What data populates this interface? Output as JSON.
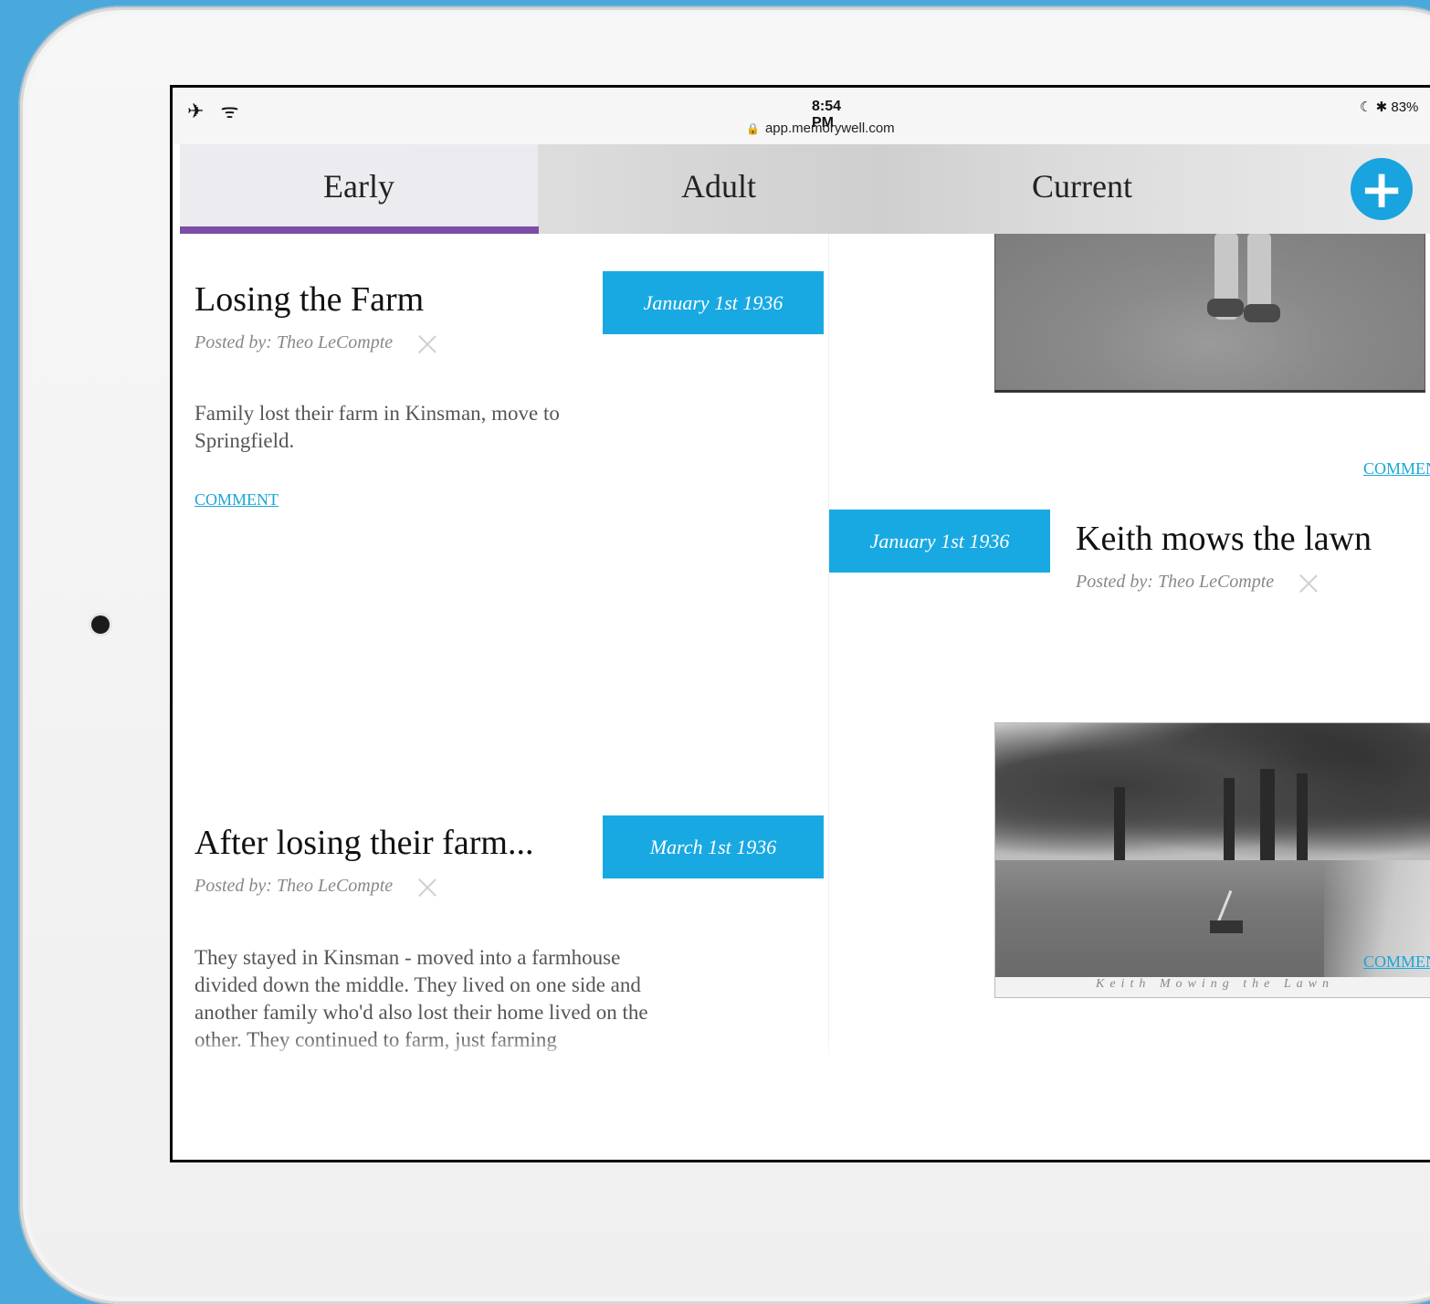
{
  "status_bar": {
    "left_icons": "✈ ᯤ",
    "time": "8:54 PM",
    "url": "app.memorywell.com",
    "battery": "83%",
    "right_icons": "☾ ✱"
  },
  "tabs": [
    {
      "label": "Early"
    },
    {
      "label": "Adult"
    },
    {
      "label": "Current"
    }
  ],
  "add_button": {
    "label": "+"
  },
  "colors": {
    "accent": "#19a9e2",
    "tab_indicator": "#7b4fa6",
    "link": "#1aa7d8"
  },
  "posts": [
    {
      "title": "Losing the Farm",
      "posted_by": "Posted by: Theo LeCompte",
      "date": "January 1st 1936",
      "body": "Family lost their farm in Kinsman, move to Springfield.",
      "comment": "COMMENT"
    },
    {
      "title": "Keith mows the lawn",
      "posted_by": "Posted by: Theo LeCompte",
      "date": "January 1st 1936",
      "comment": "COMMEN",
      "photo_caption": "Keith Mowing the Lawn"
    },
    {
      "title": "After losing their farm...",
      "posted_by": "Posted by: Theo LeCompte",
      "date": "March 1st 1936",
      "body": "They stayed in Kinsman - moved into a farmhouse divided down the middle. They lived on one side and another family who'd also lost their home lived on the other. They continued to farm, just farming"
    }
  ],
  "top_right_comment": "COMMEN"
}
